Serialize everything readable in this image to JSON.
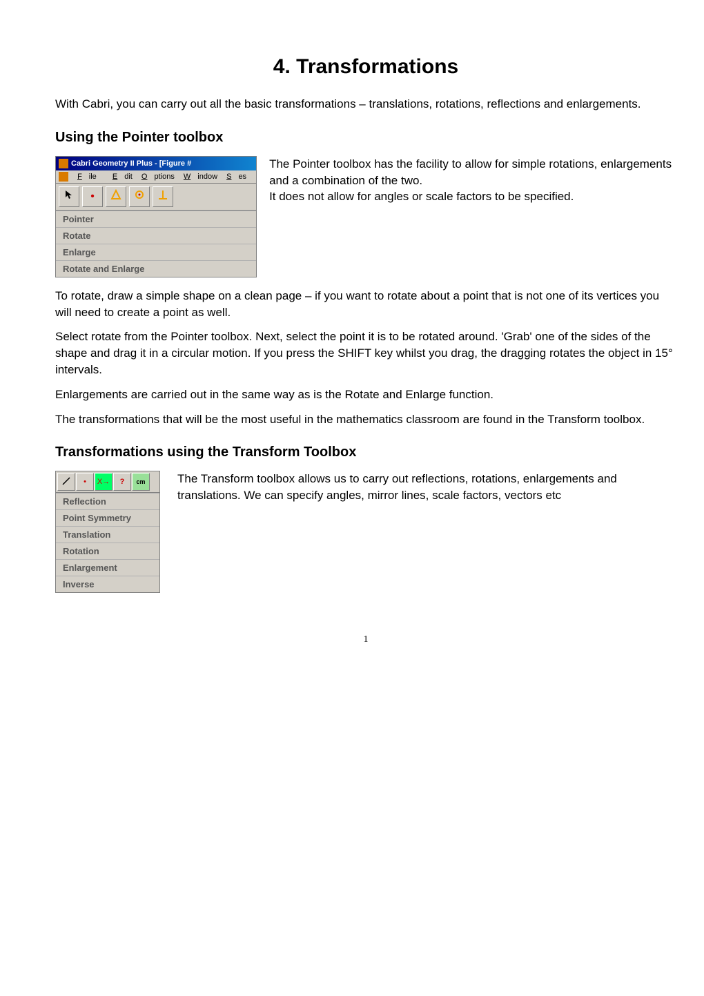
{
  "title": "4.   Transformations",
  "intro": "With Cabri, you can carry out all the basic transformations – translations, rotations, reflections and enlargements.",
  "section1": {
    "heading": "Using the Pointer toolbox",
    "cabri": {
      "titlebar": "Cabri Geometry II Plus - [Figure #",
      "menus": {
        "file": "File",
        "edit": "Edit",
        "options": "Options",
        "window": "Window",
        "ses": "Ses"
      },
      "menu_items": [
        "Pointer",
        "Rotate",
        "Enlarge",
        "Rotate and Enlarge"
      ]
    },
    "text": "The Pointer toolbox has the facility to allow for simple rotations, enlargements and a combination of the two.\nIt does not allow for angles or scale factors to be specified."
  },
  "para1": "To rotate, draw a simple shape on a clean page – if you want to rotate about a point that is not one of its vertices you will need to create a point as well.",
  "para2": "Select rotate from the Pointer toolbox.  Next, select the point it is to be rotated around.  'Grab' one of the sides of the shape and drag it in a circular motion.  If you press the SHIFT key whilst you drag, the dragging rotates the object in 15° intervals.",
  "para3": "Enlargements are carried out in the same way as is the Rotate and Enlarge function.",
  "para4": "The transformations that will be the most useful in the mathematics classroom are found in the Transform toolbox.",
  "section2": {
    "heading": "Transformations using the Transform Toolbox",
    "menu_items": [
      "Reflection",
      "Point Symmetry",
      "Translation",
      "Rotation",
      "Enlargement",
      "Inverse"
    ],
    "text": "The Transform toolbox allows us to carry out reflections, rotations, enlargements and translations.  We can specify angles, mirror lines, scale factors, vectors etc"
  },
  "page_number": "1",
  "icons": {
    "app": "app-icon",
    "pointer": "pointer-icon",
    "dot": "dot-icon",
    "triangle": "triangle-icon",
    "rotate-dot": "rotate-point-icon",
    "perp": "perp-icon",
    "line": "line-icon",
    "point": "point-icon",
    "arrow": "arrow-icon",
    "question": "question-icon",
    "cm": "cm-icon"
  }
}
